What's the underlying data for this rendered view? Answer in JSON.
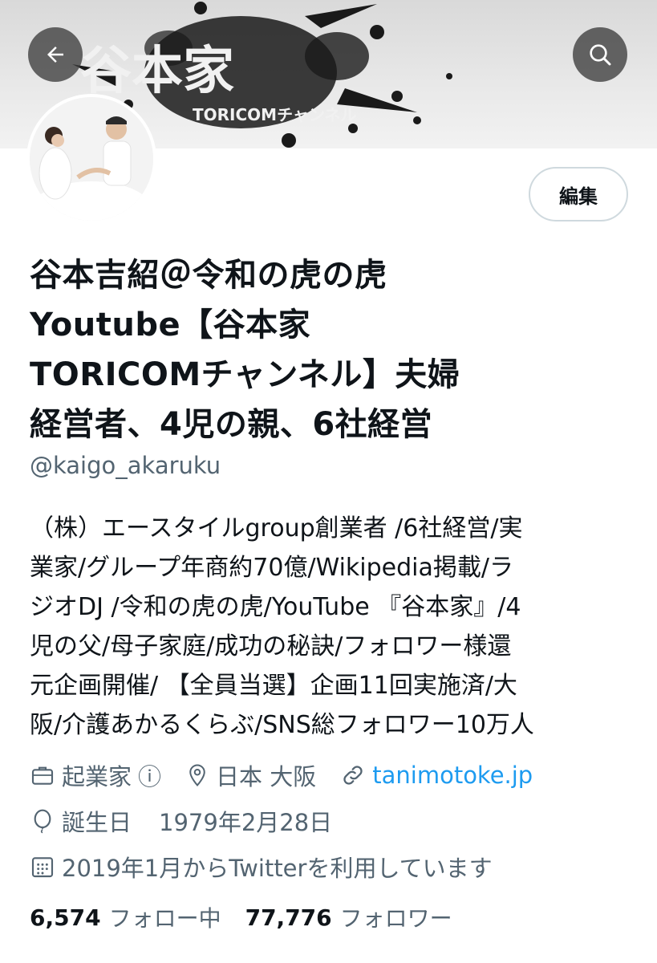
{
  "banner": {
    "logo_text": "谷本家",
    "sub_text": "TORICOMチャンネル"
  },
  "buttons": {
    "back": "back-arrow-icon",
    "search": "search-icon",
    "edit": "編集"
  },
  "profile": {
    "name_lines": [
      "谷本吉紹＠令和の虎の虎",
      "Youtube【谷本家",
      "TORICOMチャンネル】夫婦",
      "経営者、4児の親、6社経営"
    ],
    "handle": "@kaigo_akaruku",
    "bio_lines": [
      "（株）エースタイルgroup創業者 /6社経営/実",
      "業家/グループ年商約70億/Wikipedia掲載/ラ",
      "ジオDJ /令和の虎の虎/YouTube 『谷本家』/4",
      "児の父/母子家庭/成功の秘訣/フォロワー様還",
      "元企画開催/ 【全員当選】企画11回実施済/大",
      "阪/介護あかるくらぶ/SNS総フォロワー10万人"
    ],
    "category": "起業家",
    "category_info": "ⓘ",
    "location": "日本 大阪",
    "website": "tanimotoke.jp",
    "birthday_label": "誕生日",
    "birthday_value": "1979年2月28日",
    "joined": "2019年1月からTwitterを利用しています"
  },
  "stats": {
    "following_count": "6,574",
    "following_label": "フォロー中",
    "followers_count": "77,776",
    "followers_label": "フォロワー"
  },
  "colors": {
    "link": "#1d9bf0",
    "muted": "#536471",
    "text": "#0f1419"
  }
}
